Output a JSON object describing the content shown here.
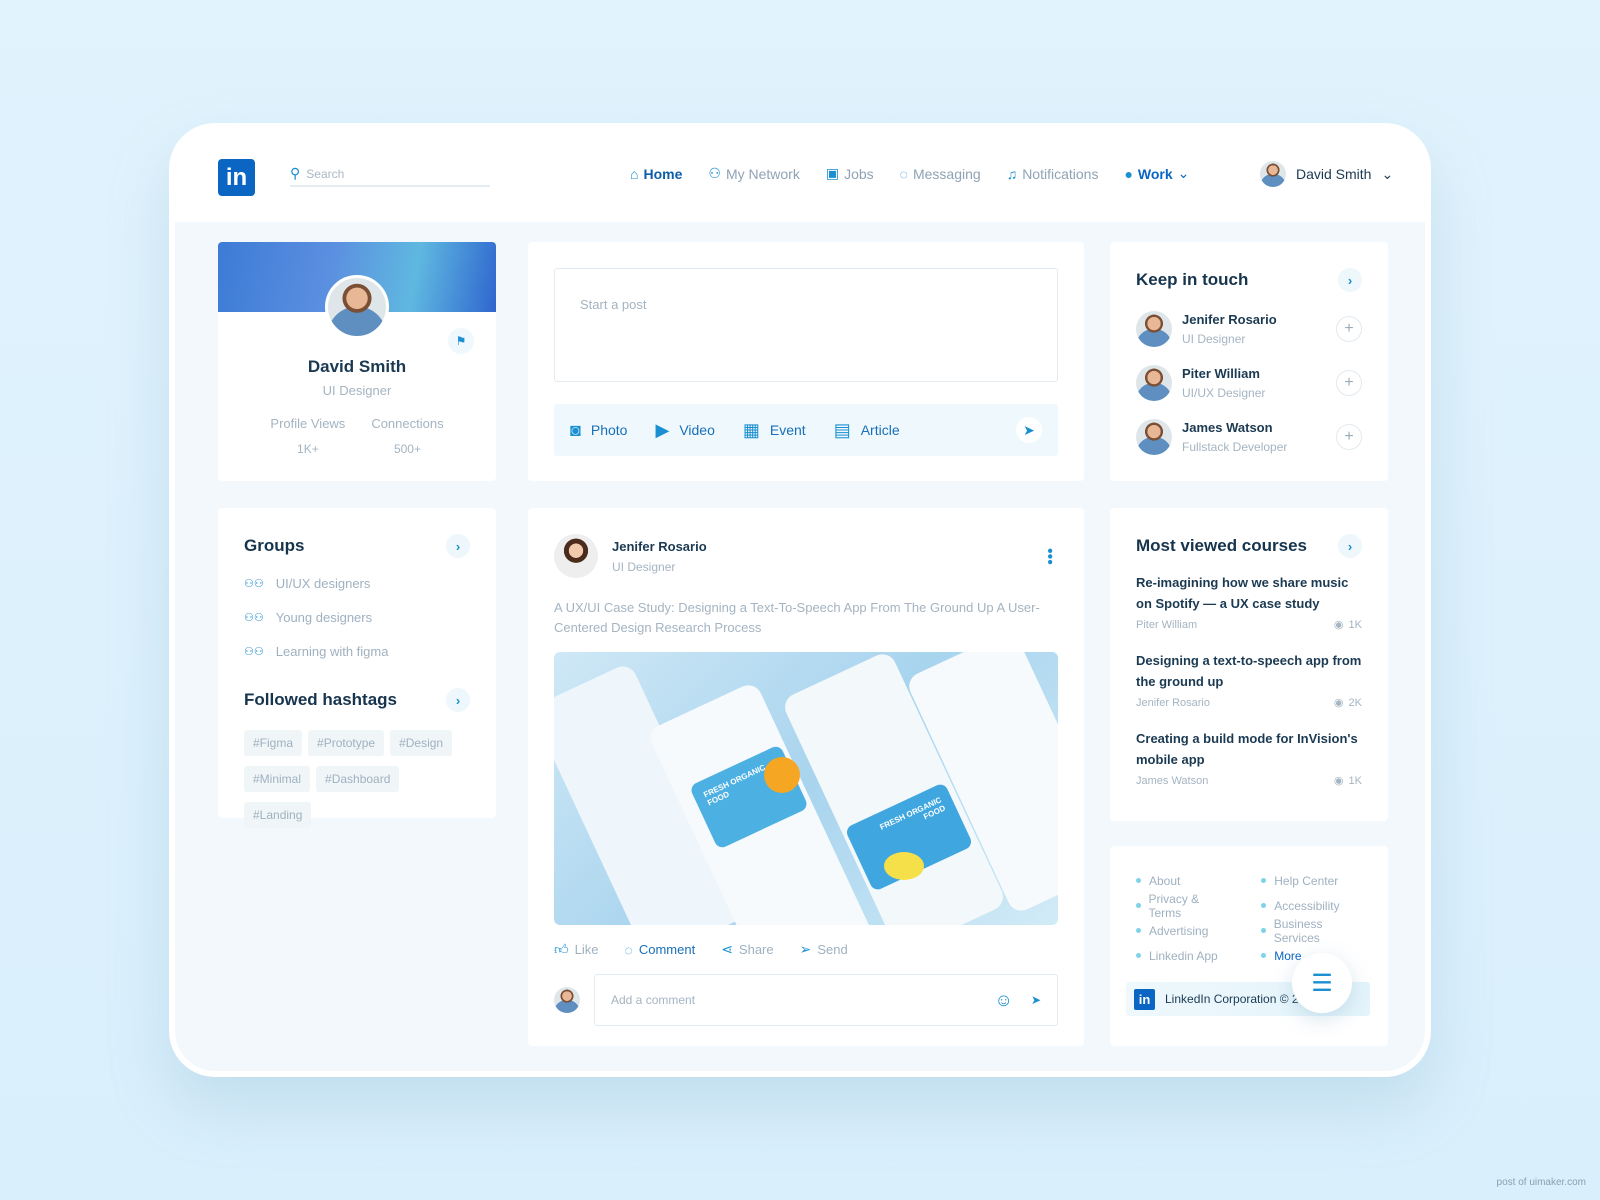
{
  "header": {
    "logo": "in",
    "search_placeholder": "Search",
    "nav": [
      {
        "label": "Home",
        "icon": "home-icon"
      },
      {
        "label": "My Network",
        "icon": "network-icon"
      },
      {
        "label": "Jobs",
        "icon": "briefcase-icon"
      },
      {
        "label": "Messaging",
        "icon": "chat-icon"
      },
      {
        "label": "Notifications",
        "icon": "bell-icon"
      },
      {
        "label": "Work",
        "icon": "user-icon"
      }
    ],
    "user_name": "David Smith"
  },
  "profile": {
    "name": "David Smith",
    "role": "UI Designer",
    "stats": [
      {
        "label": "Profile Views",
        "value": "1K+"
      },
      {
        "label": "Connections",
        "value": "500+"
      }
    ]
  },
  "groups": {
    "title": "Groups",
    "items": [
      "UI/UX designers",
      "Young designers",
      "Learning with figma"
    ]
  },
  "hashtags": {
    "title": "Followed hashtags",
    "items": [
      "#Figma",
      "#Prototype",
      "#Design",
      "#Minimal",
      "#Dashboard",
      "#Landing"
    ]
  },
  "composer": {
    "placeholder": "Start a post",
    "actions": [
      "Photo",
      "Video",
      "Event",
      "Article"
    ]
  },
  "post": {
    "author": "Jenifer Rosario",
    "role": "UI Designer",
    "text": "A UX/UI Case Study: Designing a Text-To-Speech App From The Ground Up A User-Centered Design Research Process",
    "image_labels": [
      "FRESH ORGANIC FOOD",
      "FRESH ORGANIC FOOD"
    ],
    "actions": [
      "Like",
      "Comment",
      "Share",
      "Send"
    ],
    "comment_placeholder": "Add a comment"
  },
  "keep_in_touch": {
    "title": "Keep in touch",
    "people": [
      {
        "name": "Jenifer Rosario",
        "role": "UI Designer"
      },
      {
        "name": "Piter William",
        "role": "UI/UX Designer"
      },
      {
        "name": "James Watson",
        "role": "Fullstack Developer"
      }
    ]
  },
  "courses": {
    "title": "Most viewed courses",
    "items": [
      {
        "title": "Re-imagining how we share music on Spotify — a UX case study",
        "author": "Piter William",
        "views": "1K"
      },
      {
        "title": "Designing a text-to-speech app from the ground up",
        "author": "Jenifer Rosario",
        "views": "2K"
      },
      {
        "title": "Creating a build mode for InVision's mobile app",
        "author": "James Watson",
        "views": "1K"
      }
    ]
  },
  "footer": {
    "links_left": [
      "About",
      "Privacy & Terms",
      "Advertising",
      "Linkedin App"
    ],
    "links_right": [
      "Help Center",
      "Accessibility",
      "Business Services",
      "More"
    ],
    "copyright": "LinkedIn Corporation © 20..",
    "logo": "in"
  },
  "watermark": "post of uimaker.com",
  "colors": {
    "accent": "#0a66c2",
    "bg": "#e1f3fd"
  }
}
